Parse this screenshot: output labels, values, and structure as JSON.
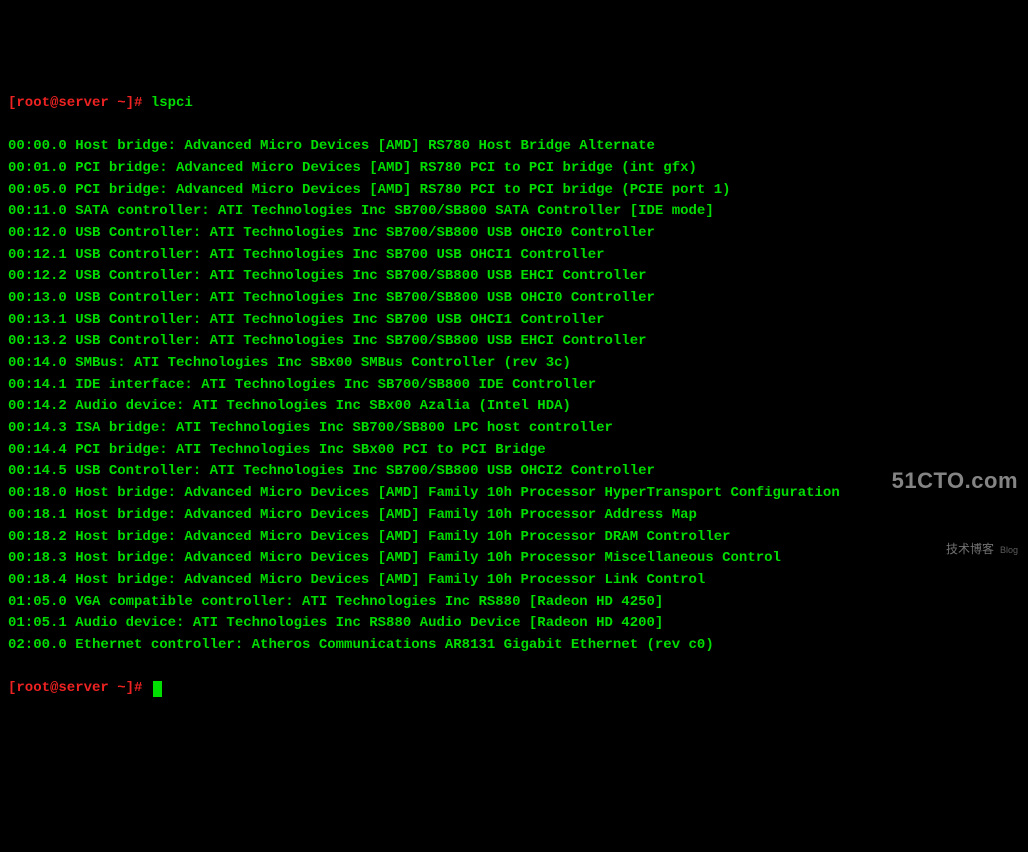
{
  "prompt": {
    "user_host": "[root@server ~]#",
    "command": "lspci"
  },
  "lines": [
    "00:00.0 Host bridge: Advanced Micro Devices [AMD] RS780 Host Bridge Alternate",
    "00:01.0 PCI bridge: Advanced Micro Devices [AMD] RS780 PCI to PCI bridge (int gfx)",
    "00:05.0 PCI bridge: Advanced Micro Devices [AMD] RS780 PCI to PCI bridge (PCIE port 1)",
    "00:11.0 SATA controller: ATI Technologies Inc SB700/SB800 SATA Controller [IDE mode]",
    "00:12.0 USB Controller: ATI Technologies Inc SB700/SB800 USB OHCI0 Controller",
    "00:12.1 USB Controller: ATI Technologies Inc SB700 USB OHCI1 Controller",
    "00:12.2 USB Controller: ATI Technologies Inc SB700/SB800 USB EHCI Controller",
    "00:13.0 USB Controller: ATI Technologies Inc SB700/SB800 USB OHCI0 Controller",
    "00:13.1 USB Controller: ATI Technologies Inc SB700 USB OHCI1 Controller",
    "00:13.2 USB Controller: ATI Technologies Inc SB700/SB800 USB EHCI Controller",
    "00:14.0 SMBus: ATI Technologies Inc SBx00 SMBus Controller (rev 3c)",
    "00:14.1 IDE interface: ATI Technologies Inc SB700/SB800 IDE Controller",
    "00:14.2 Audio device: ATI Technologies Inc SBx00 Azalia (Intel HDA)",
    "00:14.3 ISA bridge: ATI Technologies Inc SB700/SB800 LPC host controller",
    "00:14.4 PCI bridge: ATI Technologies Inc SBx00 PCI to PCI Bridge",
    "00:14.5 USB Controller: ATI Technologies Inc SB700/SB800 USB OHCI2 Controller",
    "00:18.0 Host bridge: Advanced Micro Devices [AMD] Family 10h Processor HyperTransport Configuration",
    "00:18.1 Host bridge: Advanced Micro Devices [AMD] Family 10h Processor Address Map",
    "00:18.2 Host bridge: Advanced Micro Devices [AMD] Family 10h Processor DRAM Controller",
    "00:18.3 Host bridge: Advanced Micro Devices [AMD] Family 10h Processor Miscellaneous Control",
    "00:18.4 Host bridge: Advanced Micro Devices [AMD] Family 10h Processor Link Control",
    "01:05.0 VGA compatible controller: ATI Technologies Inc RS880 [Radeon HD 4250]",
    "01:05.1 Audio device: ATI Technologies Inc RS880 Audio Device [Radeon HD 4200]",
    "02:00.0 Ethernet controller: Atheros Communications AR8131 Gigabit Ethernet (rev c0)"
  ],
  "prompt2": {
    "user_host": "[root@server ~]#"
  },
  "watermark": {
    "main": "51CTO.com",
    "sub": "技术博客",
    "blog": "Blog"
  }
}
